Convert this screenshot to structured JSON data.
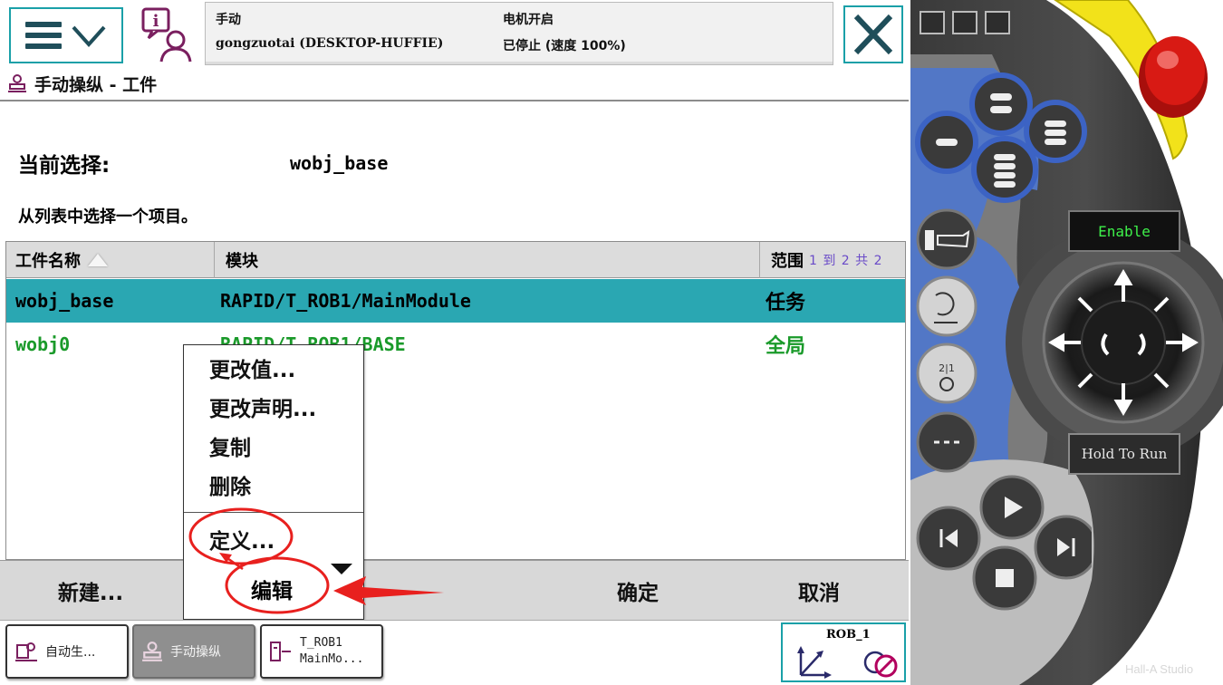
{
  "status": {
    "mode": "手动",
    "station": "gongzuotai (DESKTOP-HUFFIE)",
    "motor": "电机开启",
    "state": "已停止 (速度 100%)"
  },
  "app": {
    "title": "手动操纵 - 工件"
  },
  "selection": {
    "label": "当前选择:",
    "value": "wobj_base",
    "instruction": "从列表中选择一个项目。"
  },
  "table": {
    "columns": {
      "name": "工件名称",
      "module": "模块",
      "scope": "范围",
      "range": "1 到 2 共 2"
    },
    "rows": [
      {
        "name": "wobj_base",
        "module": "RAPID/T_ROB1/MainModule",
        "scope": "任务"
      },
      {
        "name": "wobj0",
        "module": "RAPID/T_ROB1/BASE",
        "scope": "全局"
      }
    ]
  },
  "context_menu": {
    "items": [
      "更改值...",
      "更改声明...",
      "复制",
      "删除",
      "定义..."
    ],
    "edit": "编辑"
  },
  "commands": {
    "new": "新建...",
    "ok": "确定",
    "cancel": "取消"
  },
  "taskbar": {
    "auto": "自动生...",
    "jog": "手动操纵",
    "rob_line1": "T_ROB1",
    "rob_line2": "MainMo...",
    "quickset": "ROB_1"
  },
  "device": {
    "enable": "Enable",
    "hold_to_run": "Hold To Run",
    "watermark": "Hall-A Studio"
  },
  "colors": {
    "accent_teal": "#1aa0a8",
    "selected_row": "#2aa7b2",
    "green_text": "#1a9a2a",
    "annotation_red": "#e8201e",
    "device_blue": "#5277c6",
    "emergency_red": "#d81a14",
    "guard_yellow": "#f2e21a"
  }
}
